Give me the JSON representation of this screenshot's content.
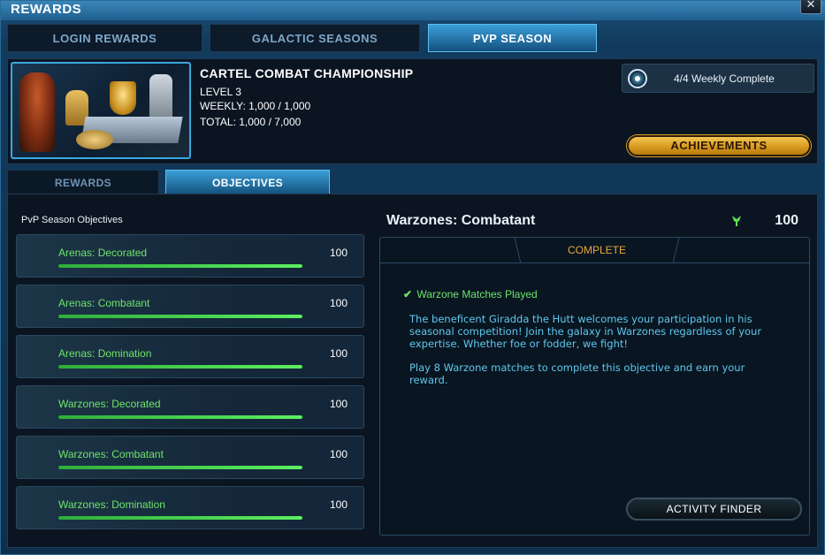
{
  "window": {
    "title": "REWARDS",
    "close_label": "✕"
  },
  "top_tabs": [
    {
      "label": "LOGIN REWARDS",
      "active": false
    },
    {
      "label": "GALACTIC SEASONS",
      "active": false
    },
    {
      "label": "PVP SEASON",
      "active": true
    }
  ],
  "header": {
    "title": "CARTEL COMBAT CHAMPIONSHIP",
    "level": "LEVEL 3",
    "weekly": "WEEKLY: 1,000 / 1,000",
    "total": "TOTAL: 1,000 / 7,000",
    "weekly_status": "4/4 Weekly Complete",
    "achievements_label": "ACHIEVEMENTS"
  },
  "sub_tabs": [
    {
      "label": "REWARDS",
      "active": false
    },
    {
      "label": "OBJECTIVES",
      "active": true
    }
  ],
  "objectives": {
    "heading": "PvP Season Objectives",
    "items": [
      {
        "name": "Arenas: Decorated",
        "value": "100",
        "progress": 1.0
      },
      {
        "name": "Arenas: Combatant",
        "value": "100",
        "progress": 1.0
      },
      {
        "name": "Arenas: Domination",
        "value": "100",
        "progress": 1.0
      },
      {
        "name": "Warzones: Decorated",
        "value": "100",
        "progress": 1.0
      },
      {
        "name": "Warzones: Combatant",
        "value": "100",
        "progress": 1.0
      },
      {
        "name": "Warzones: Domination",
        "value": "100",
        "progress": 1.0
      }
    ]
  },
  "detail": {
    "title": "Warzones: Combatant",
    "reward_value": "100",
    "status": "COMPLETE",
    "check_icon": "✔",
    "requirement": "Warzone Matches Played",
    "description_1": "The beneficent Giradda the Hutt welcomes your participation in his seasonal competition! Join the galaxy in Warzones regardless of your expertise. Whether foe or fodder, we fight!",
    "description_2": "Play 8 Warzone matches to complete this objective and earn your reward.",
    "activity_finder_label": "ACTIVITY FINDER"
  },
  "colors": {
    "accent": "#3a9ed8",
    "complete_green": "#6ee46a",
    "gold_button": "#d99a1e",
    "complete_status": "#e8a83a",
    "description_text": "#5fc8ee"
  }
}
